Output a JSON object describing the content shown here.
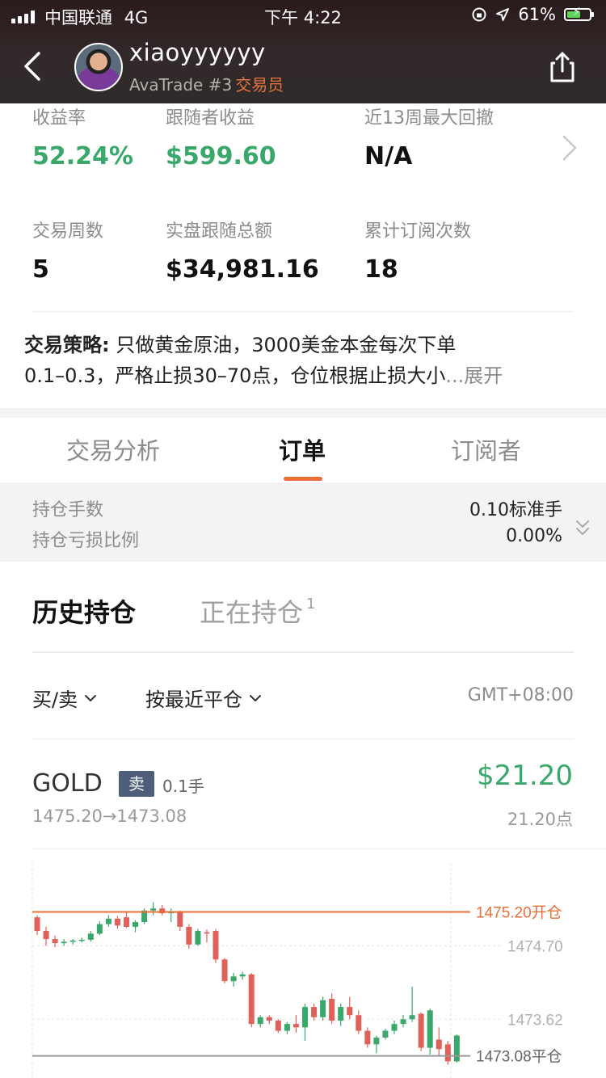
{
  "status_bar": {
    "carrier": "中国联通",
    "network": "4G",
    "time": "下午 4:22",
    "battery": "61%",
    "battery_level": 0.61
  },
  "header": {
    "username": "xiaoyyyyyy",
    "broker": "AvaTrade #3",
    "role": "交易员",
    "back_icon": "chevron-left-icon",
    "share_icon": "share-icon"
  },
  "stats": [
    {
      "label": "收益率",
      "value": "52.24%"
    },
    {
      "label": "跟随者收益",
      "value": "$599.60"
    },
    {
      "label": "近13周最大回撤",
      "value": "N/A"
    },
    {
      "label": "交易周数",
      "value": "5"
    },
    {
      "label": "实盘跟随总额",
      "value": "$34,981.16"
    },
    {
      "label": "累计订阅次数",
      "value": "18"
    }
  ],
  "strategy": {
    "label": "交易策略:",
    "line1": "只做黄金原油，3000美金本金每次下单",
    "line2": "0.1–0.3，严格止损30–70点，仓位根据止损大小",
    "more": "...展开"
  },
  "tabs": [
    "交易分析",
    "订单",
    "订阅者"
  ],
  "active_tab": 1,
  "summary": {
    "lots_label": "持仓手数",
    "lots_value": "0.10标准手",
    "pl_ratio_label": "持仓亏损比例",
    "pl_ratio_value": "0.00%"
  },
  "position_tabs": {
    "history": "历史持仓",
    "open": "正在持仓",
    "open_count": "1"
  },
  "filters": {
    "side": "买/卖",
    "sort": "按最近平仓",
    "timezone": "GMT+08:00"
  },
  "trade": {
    "symbol": "GOLD",
    "side": "卖",
    "lots": "0.1手",
    "profit": "$21.20",
    "price_path": "1475.20→1473.08",
    "points": "21.20点"
  },
  "chart_data": {
    "type": "candlestick",
    "open_price": 1475.2,
    "close_price": 1473.08,
    "open_label": "1475.20开仓",
    "close_label": "1473.08平仓",
    "tick_labels": [
      "1474.70",
      "1473.62"
    ],
    "ylim": [
      1472.85,
      1475.8
    ],
    "candles": [
      {
        "o": 1475.12,
        "h": 1475.15,
        "l": 1474.86,
        "c": 1474.92
      },
      {
        "o": 1474.92,
        "h": 1474.98,
        "l": 1474.7,
        "c": 1474.8
      },
      {
        "o": 1474.8,
        "h": 1474.85,
        "l": 1474.68,
        "c": 1474.74
      },
      {
        "o": 1474.74,
        "h": 1474.8,
        "l": 1474.7,
        "c": 1474.76
      },
      {
        "o": 1474.76,
        "h": 1474.8,
        "l": 1474.72,
        "c": 1474.78
      },
      {
        "o": 1474.78,
        "h": 1474.82,
        "l": 1474.75,
        "c": 1474.79
      },
      {
        "o": 1474.79,
        "h": 1474.92,
        "l": 1474.76,
        "c": 1474.88
      },
      {
        "o": 1474.88,
        "h": 1475.06,
        "l": 1474.86,
        "c": 1475.02
      },
      {
        "o": 1475.02,
        "h": 1475.15,
        "l": 1474.98,
        "c": 1475.1
      },
      {
        "o": 1475.1,
        "h": 1475.14,
        "l": 1474.95,
        "c": 1475.0
      },
      {
        "o": 1475.12,
        "h": 1475.2,
        "l": 1474.96,
        "c": 1474.98
      },
      {
        "o": 1474.98,
        "h": 1475.08,
        "l": 1474.9,
        "c": 1475.05
      },
      {
        "o": 1475.05,
        "h": 1475.25,
        "l": 1475.02,
        "c": 1475.22
      },
      {
        "o": 1475.22,
        "h": 1475.34,
        "l": 1475.15,
        "c": 1475.25
      },
      {
        "o": 1475.25,
        "h": 1475.3,
        "l": 1475.15,
        "c": 1475.18
      },
      {
        "o": 1475.18,
        "h": 1475.25,
        "l": 1475.05,
        "c": 1475.2
      },
      {
        "o": 1475.2,
        "h": 1475.22,
        "l": 1474.92,
        "c": 1474.98
      },
      {
        "o": 1474.98,
        "h": 1475.02,
        "l": 1474.66,
        "c": 1474.72
      },
      {
        "o": 1474.72,
        "h": 1474.95,
        "l": 1474.7,
        "c": 1474.92
      },
      {
        "o": 1474.9,
        "h": 1474.94,
        "l": 1474.75,
        "c": 1474.88
      },
      {
        "o": 1474.92,
        "h": 1474.95,
        "l": 1474.45,
        "c": 1474.5
      },
      {
        "o": 1474.5,
        "h": 1474.52,
        "l": 1474.15,
        "c": 1474.18
      },
      {
        "o": 1474.18,
        "h": 1474.3,
        "l": 1474.1,
        "c": 1474.25
      },
      {
        "o": 1474.25,
        "h": 1474.32,
        "l": 1474.2,
        "c": 1474.28
      },
      {
        "o": 1474.28,
        "h": 1474.3,
        "l": 1473.5,
        "c": 1473.55
      },
      {
        "o": 1473.55,
        "h": 1473.68,
        "l": 1473.5,
        "c": 1473.65
      },
      {
        "o": 1473.65,
        "h": 1473.68,
        "l": 1473.55,
        "c": 1473.6
      },
      {
        "o": 1473.6,
        "h": 1473.62,
        "l": 1473.42,
        "c": 1473.45
      },
      {
        "o": 1473.45,
        "h": 1473.58,
        "l": 1473.4,
        "c": 1473.55
      },
      {
        "o": 1473.55,
        "h": 1473.68,
        "l": 1473.42,
        "c": 1473.5
      },
      {
        "o": 1473.5,
        "h": 1473.85,
        "l": 1473.3,
        "c": 1473.8
      },
      {
        "o": 1473.8,
        "h": 1473.85,
        "l": 1473.6,
        "c": 1473.65
      },
      {
        "o": 1473.65,
        "h": 1473.95,
        "l": 1473.6,
        "c": 1473.9
      },
      {
        "o": 1473.92,
        "h": 1474.0,
        "l": 1473.55,
        "c": 1473.6
      },
      {
        "o": 1473.6,
        "h": 1473.85,
        "l": 1473.52,
        "c": 1473.8
      },
      {
        "o": 1473.8,
        "h": 1473.95,
        "l": 1473.62,
        "c": 1473.68
      },
      {
        "o": 1473.68,
        "h": 1473.75,
        "l": 1473.4,
        "c": 1473.45
      },
      {
        "o": 1473.45,
        "h": 1473.5,
        "l": 1473.2,
        "c": 1473.25
      },
      {
        "o": 1473.25,
        "h": 1473.38,
        "l": 1473.12,
        "c": 1473.35
      },
      {
        "o": 1473.35,
        "h": 1473.48,
        "l": 1473.32,
        "c": 1473.45
      },
      {
        "o": 1473.45,
        "h": 1473.6,
        "l": 1473.4,
        "c": 1473.55
      },
      {
        "o": 1473.55,
        "h": 1473.68,
        "l": 1473.5,
        "c": 1473.62
      },
      {
        "o": 1473.62,
        "h": 1474.1,
        "l": 1473.58,
        "c": 1473.68
      },
      {
        "o": 1473.7,
        "h": 1473.72,
        "l": 1473.15,
        "c": 1473.2
      },
      {
        "o": 1473.2,
        "h": 1473.78,
        "l": 1473.1,
        "c": 1473.75
      },
      {
        "o": 1473.32,
        "h": 1473.5,
        "l": 1473.08,
        "c": 1473.18
      },
      {
        "o": 1473.25,
        "h": 1473.3,
        "l": 1472.95,
        "c": 1473.0
      },
      {
        "o": 1473.0,
        "h": 1473.4,
        "l": 1472.98,
        "c": 1473.38
      }
    ]
  },
  "colors": {
    "up": "#3aa86a",
    "down": "#e0605a",
    "accent": "#e96f36",
    "close_line": "#9a9a9a"
  }
}
